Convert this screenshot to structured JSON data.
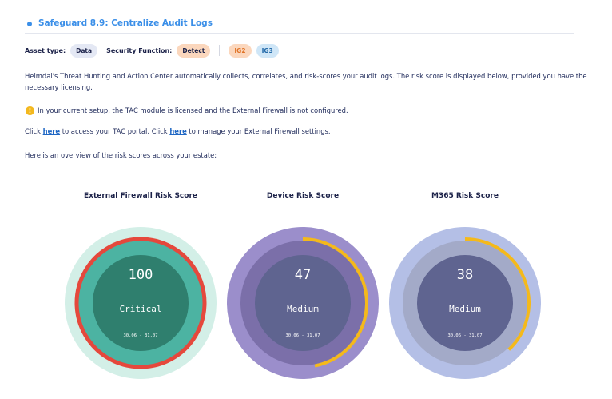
{
  "header": {
    "title": "Safeguard 8.9: Centralize Audit Logs"
  },
  "meta": {
    "asset_type_label": "Asset type:",
    "asset_type_value": "Data",
    "security_function_label": "Security Function:",
    "security_function_value": "Detect",
    "tags": [
      "IG2",
      "IG3"
    ]
  },
  "body": {
    "intro": "Heimdal's Threat Hunting and Action Center automatically collects, correlates, and risk-scores your audit logs. The risk score is displayed below, provided you have the necessary licensing.",
    "warning_icon": "exclamation-circle-icon",
    "warning_text": "In your current setup, the TAC module is licensed and the External Firewall is not configured.",
    "links_line": {
      "prefix": "Click ",
      "link1": "here",
      "middle": " to access your TAC portal. Click ",
      "link2": "here",
      "suffix": " to manage your External Firewall settings."
    },
    "overview": "Here is an overview of the risk scores across your estate:"
  },
  "gauges": [
    {
      "title": "External Firewall Risk Score",
      "score": "100",
      "level": "Critical",
      "fraction": 1.0,
      "period": "30.06 - 31.07",
      "colors": {
        "outer": "#d3efe7",
        "middle": "#4cb3a2",
        "inner": "#2f7f6e",
        "arc": "#e5483c"
      }
    },
    {
      "title": "Device Risk Score",
      "score": "47",
      "level": "Medium",
      "fraction": 0.47,
      "period": "30.06 - 31.07",
      "colors": {
        "outer": "#9b8ecb",
        "middle": "#7b6fa9",
        "inner": "#5f6490",
        "arc": "#f4b91b"
      }
    },
    {
      "title": "M365 Risk Score",
      "score": "38",
      "level": "Medium",
      "fraction": 0.38,
      "period": "30.06 - 31.07",
      "colors": {
        "outer": "#b4bfe6",
        "middle": "#a3aac8",
        "inner": "#5f6490",
        "arc": "#f4b91b"
      }
    }
  ]
}
